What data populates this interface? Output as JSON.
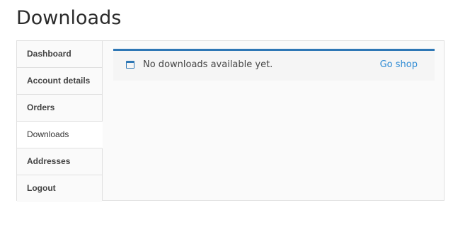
{
  "page": {
    "title": "Downloads"
  },
  "nav": {
    "items": [
      {
        "label": "Dashboard",
        "active": false
      },
      {
        "label": "Account details",
        "active": false
      },
      {
        "label": "Orders",
        "active": false
      },
      {
        "label": "Downloads",
        "active": true
      },
      {
        "label": "Addresses",
        "active": false
      },
      {
        "label": "Logout",
        "active": false
      }
    ]
  },
  "notice": {
    "icon": "window-icon",
    "message": "No downloads available yet.",
    "link_label": "Go shop",
    "accent_color": "#2e77b5"
  }
}
